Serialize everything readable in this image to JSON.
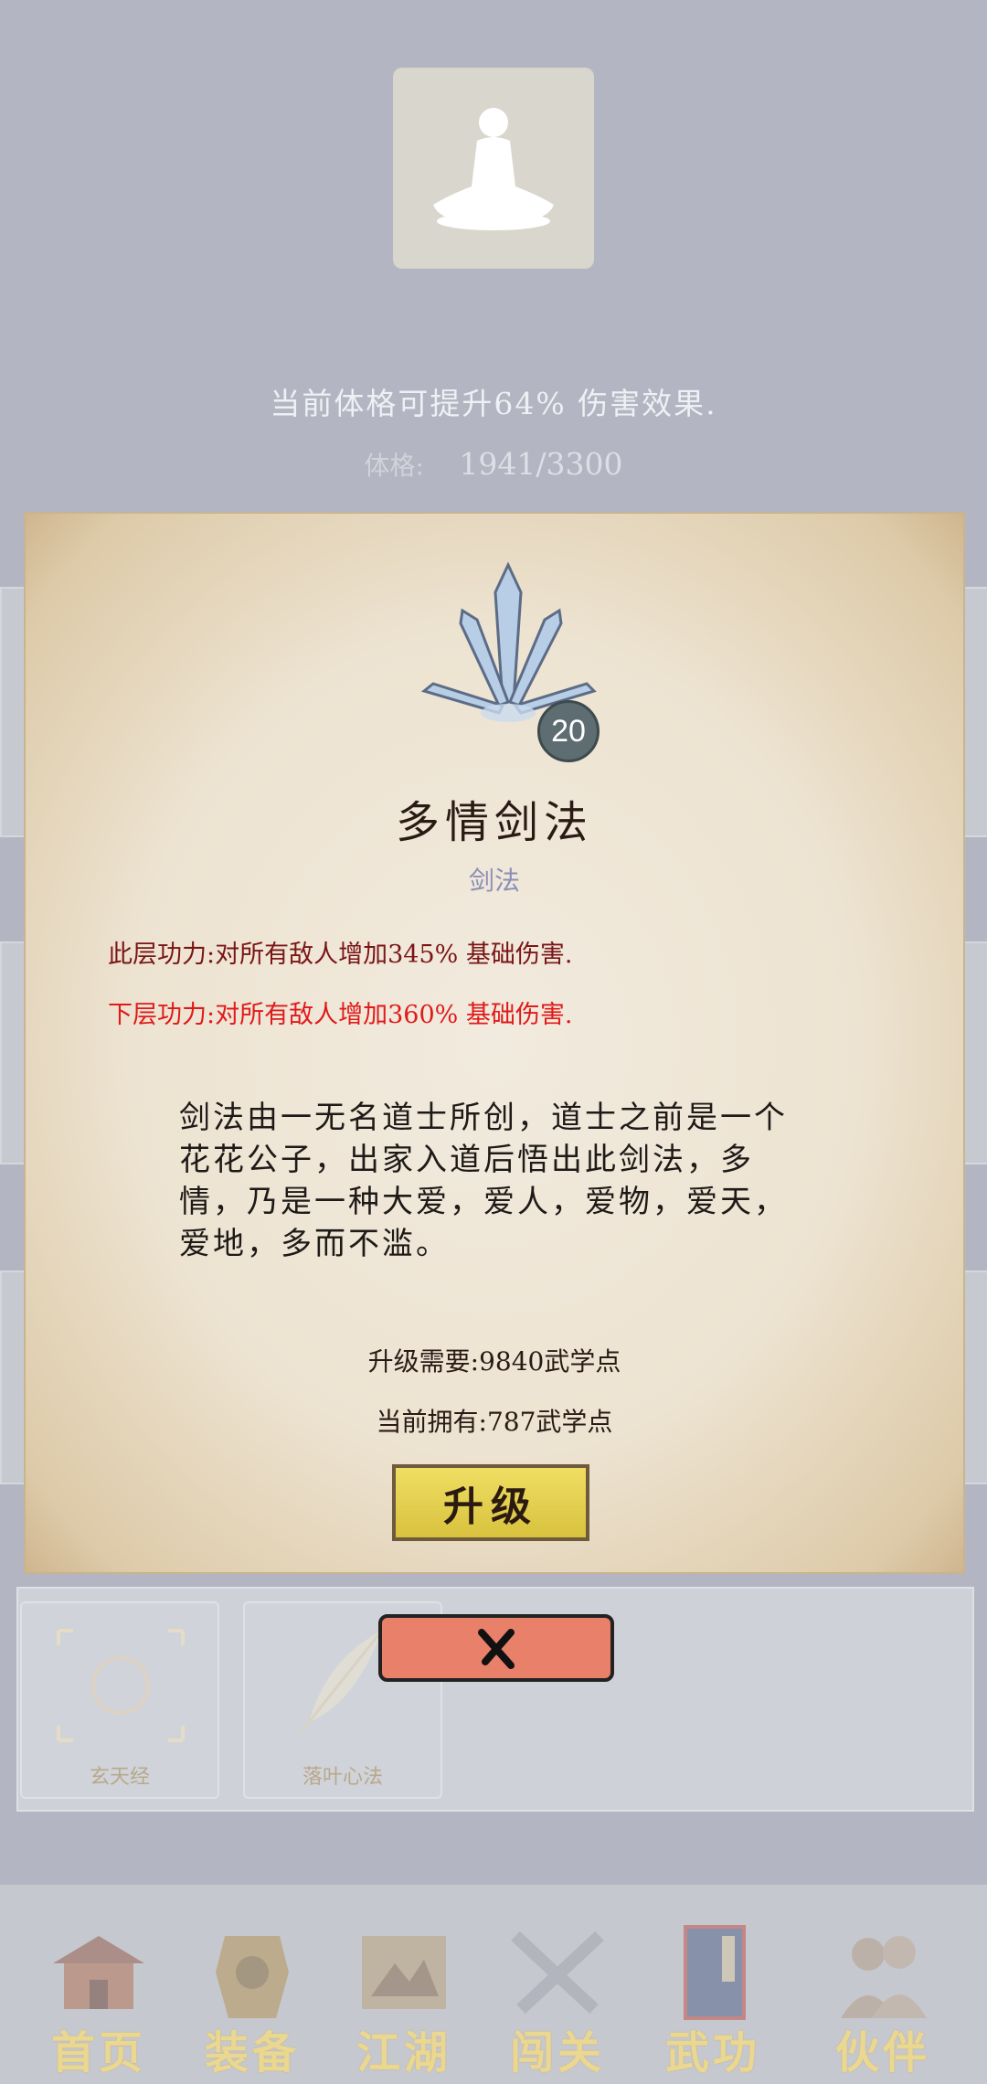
{
  "header": {
    "bonus_text": "当前体格可提升64% 伤害效果.",
    "stat_label": "体格:",
    "stat_value": "1941/3300"
  },
  "skill_card": {
    "level": "20",
    "name": "多情剑法",
    "type": "剑法",
    "current_effect": "此层功力:对所有敌人增加345% 基础伤害.",
    "next_effect": "下层功力:对所有敌人增加360% 基础伤害.",
    "description": "剑法由一无名道士所创，道士之前是一个花花公子，出家入道后悟出此剑法，多情，乃是一种大爱，爱人，爱物，爱天，爱地，多而不滥。",
    "upgrade_requirement": "升级需要:9840武学点",
    "current_points": "当前拥有:787武学点",
    "upgrade_label": "升级",
    "close_label": "✕"
  },
  "skill_list": [
    {
      "label": "玄天经"
    },
    {
      "label": "落叶心法"
    }
  ],
  "bottom_nav": [
    {
      "label": "首页",
      "icon": "temple-icon"
    },
    {
      "label": "装备",
      "icon": "armor-icon"
    },
    {
      "label": "江湖",
      "icon": "map-scroll-icon"
    },
    {
      "label": "闯关",
      "icon": "crossed-swords-icon"
    },
    {
      "label": "武功",
      "icon": "manual-book-icon"
    },
    {
      "label": "伙伴",
      "icon": "partners-icon"
    }
  ],
  "colors": {
    "background": "#b3b6c2",
    "parchment": "#ede3d1",
    "current_effect": "#7a1515",
    "next_effect": "#e01a1a",
    "upgrade_button": "#e6d250",
    "close_button": "#e98069",
    "nav_label": "#efd98a"
  }
}
